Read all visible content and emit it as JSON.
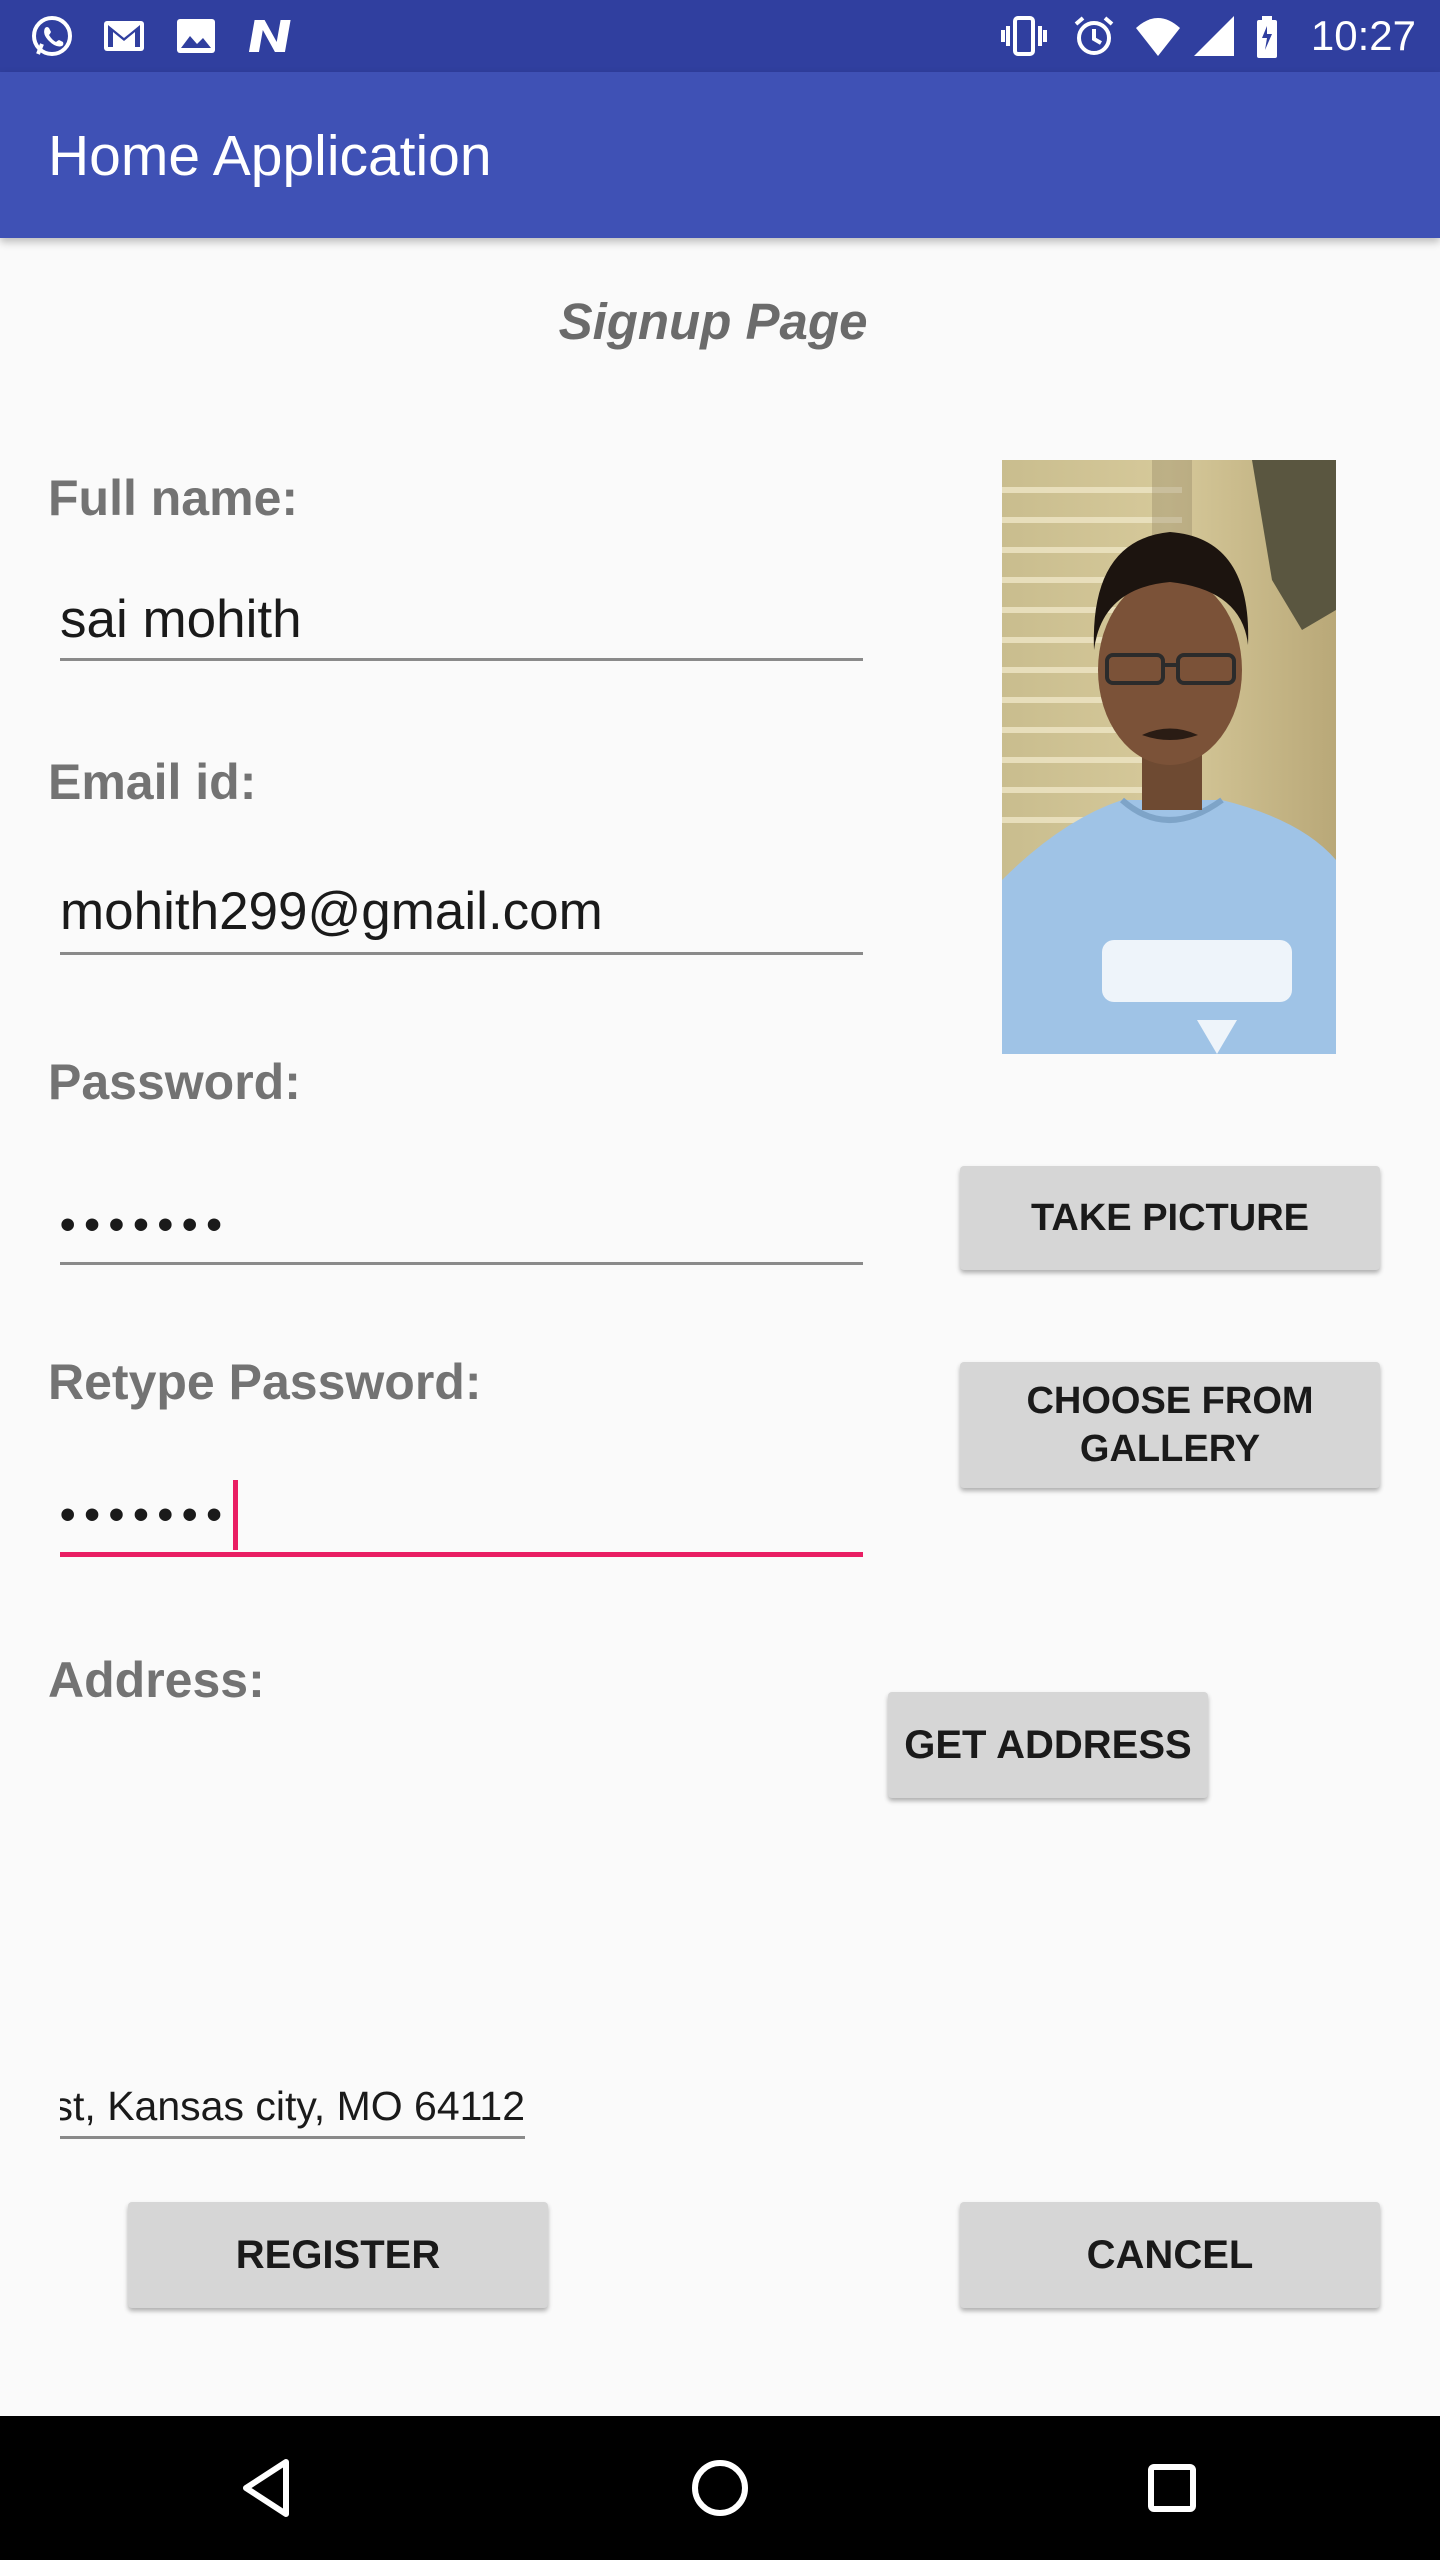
{
  "status_bar": {
    "time": "10:27",
    "left_icons": [
      "whatsapp-icon",
      "gmail-icon",
      "image-icon",
      "n-notification-icon"
    ],
    "right_icons": [
      "vibrate-icon",
      "alarm-icon",
      "wifi-icon",
      "signal-icon",
      "battery-icon"
    ],
    "background": "#303f9f"
  },
  "app_bar": {
    "title": "Home Application",
    "background": "#3f51b5"
  },
  "page": {
    "heading": "Signup Page"
  },
  "form": {
    "full_name_label": "Full name:",
    "full_name_value": "sai mohith",
    "email_label": "Email id:",
    "email_value": "mohith299@gmail.com",
    "password_label": "Password:",
    "password_value": "•••••••",
    "retype_password_label": "Retype Password:",
    "retype_password_value": "•••••••",
    "address_label": "Address:",
    "address_value": "st, Kansas city, MO 64112"
  },
  "buttons": {
    "take_picture": "TAKE PICTURE",
    "choose_from_gallery_line1": "CHOOSE FROM",
    "choose_from_gallery_line2": "GALLERY",
    "get_address": "GET ADDRESS",
    "register": "REGISTER",
    "cancel": "CANCEL"
  },
  "colors": {
    "accent": "#e91e63",
    "button_bg": "#d6d6d6",
    "label": "#737373"
  }
}
